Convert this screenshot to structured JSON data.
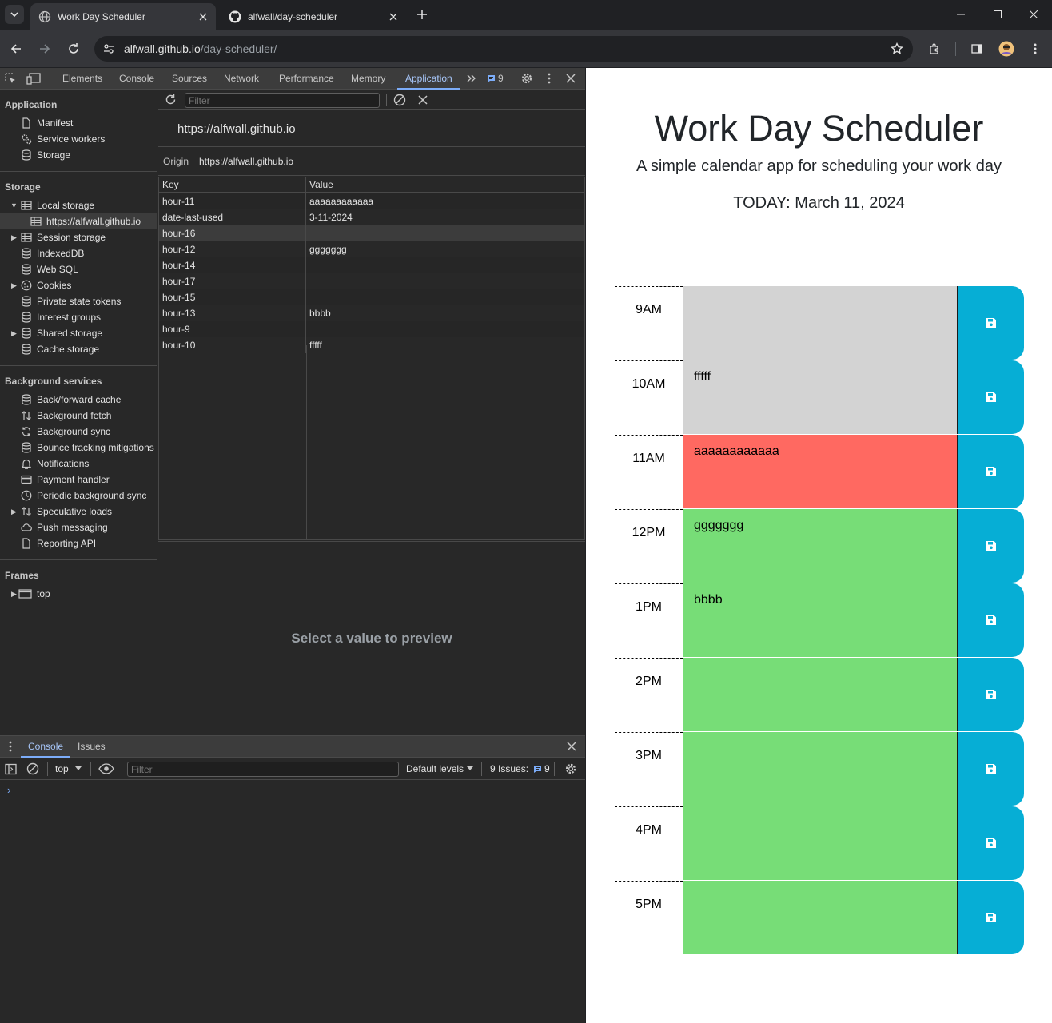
{
  "browser": {
    "tabs": [
      {
        "title": "Work Day Scheduler",
        "active": true
      },
      {
        "title": "alfwall/day-scheduler",
        "active": false
      }
    ],
    "url_host": "alfwall.github.io",
    "url_path": "/day-scheduler/"
  },
  "devtools": {
    "tabs": [
      "Elements",
      "Console",
      "Sources",
      "Network",
      "Performance",
      "Memory",
      "Application"
    ],
    "active_tab": "Application",
    "issues_count": "9",
    "sidebar": {
      "application_title": "Application",
      "application_items": [
        "Manifest",
        "Service workers",
        "Storage"
      ],
      "storage_title": "Storage",
      "storage_items": [
        "Local storage",
        "https://alfwall.github.io",
        "Session storage",
        "IndexedDB",
        "Web SQL",
        "Cookies",
        "Private state tokens",
        "Interest groups",
        "Shared storage",
        "Cache storage"
      ],
      "background_title": "Background services",
      "background_items": [
        "Back/forward cache",
        "Background fetch",
        "Background sync",
        "Bounce tracking mitigations",
        "Notifications",
        "Payment handler",
        "Periodic background sync",
        "Speculative loads",
        "Push messaging",
        "Reporting API"
      ],
      "frames_title": "Frames",
      "frames_items": [
        "top"
      ]
    },
    "filter_placeholder": "Filter",
    "origin_heading": "https://alfwall.github.io",
    "origin_label": "Origin",
    "origin_value": "https://alfwall.github.io",
    "grid": {
      "headers": [
        "Key",
        "Value"
      ],
      "rows": [
        {
          "key": "hour-11",
          "value": "aaaaaaaaaaaa"
        },
        {
          "key": "date-last-used",
          "value": "3-11-2024"
        },
        {
          "key": "hour-16",
          "value": ""
        },
        {
          "key": "hour-12",
          "value": "ggggggg"
        },
        {
          "key": "hour-14",
          "value": ""
        },
        {
          "key": "hour-17",
          "value": ""
        },
        {
          "key": "hour-15",
          "value": ""
        },
        {
          "key": "hour-13",
          "value": "bbbb"
        },
        {
          "key": "hour-9",
          "value": ""
        },
        {
          "key": "hour-10",
          "value": "fffff"
        }
      ]
    },
    "preview_text": "Select a value to preview",
    "drawer": {
      "tabs": [
        "Console",
        "Issues"
      ],
      "context": "top",
      "filter_placeholder": "Filter",
      "levels": "Default levels",
      "issues_label": "9 Issues:",
      "issues_count": "9",
      "prompt": "›"
    }
  },
  "page": {
    "title": "Work Day Scheduler",
    "lead": "A simple calendar app for scheduling your work day",
    "today": "TODAY: March 11, 2024",
    "hours": [
      {
        "label": "9AM",
        "text": "",
        "state": "past"
      },
      {
        "label": "10AM",
        "text": "fffff",
        "state": "past"
      },
      {
        "label": "11AM",
        "text": "aaaaaaaaaaaa",
        "state": "present"
      },
      {
        "label": "12PM",
        "text": "ggggggg",
        "state": "future"
      },
      {
        "label": "1PM",
        "text": "bbbb",
        "state": "future"
      },
      {
        "label": "2PM",
        "text": "",
        "state": "future"
      },
      {
        "label": "3PM",
        "text": "",
        "state": "future"
      },
      {
        "label": "4PM",
        "text": "",
        "state": "future"
      },
      {
        "label": "5PM",
        "text": "",
        "state": "future"
      }
    ],
    "colors": {
      "past": "#d3d3d3",
      "present": "#ff6961",
      "future": "#77dd77",
      "save": "#06aed5"
    }
  }
}
